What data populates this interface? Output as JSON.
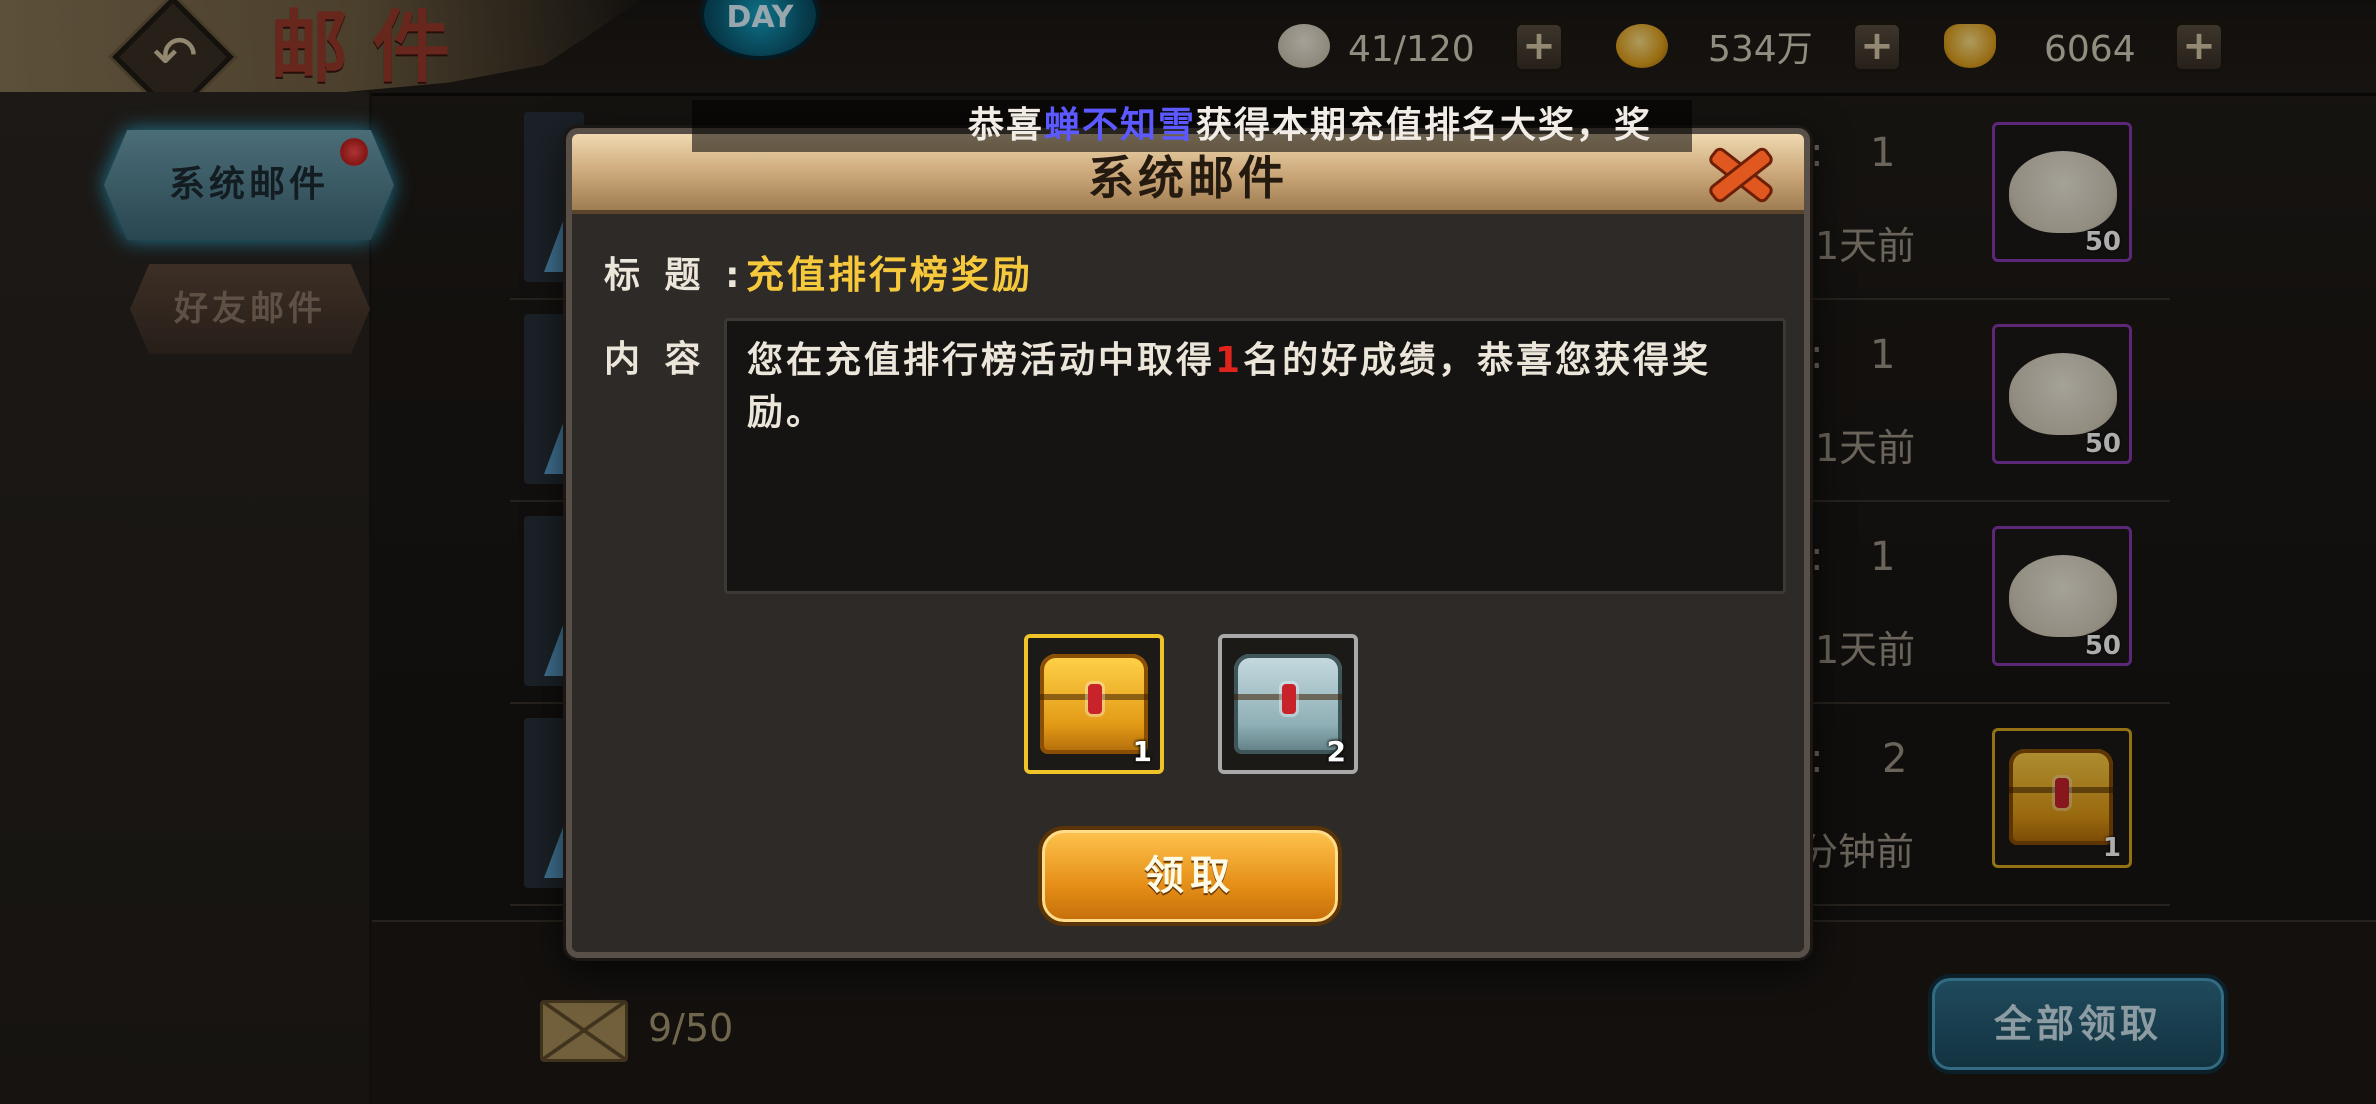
{
  "header": {
    "title": "邮件",
    "logo_text": "DAY"
  },
  "resources": [
    {
      "icon": "bun-icon",
      "value": "41/120"
    },
    {
      "icon": "gold-coin-icon",
      "value": "534万"
    },
    {
      "icon": "gold-ingot-icon",
      "value": "6064"
    }
  ],
  "sidebar": {
    "tabs": [
      {
        "label": "系统邮件",
        "active": true,
        "has_notice": true
      },
      {
        "label": "好友邮件",
        "active": false,
        "has_notice": false
      }
    ]
  },
  "mail_list": {
    "rows": [
      {
        "count": "1",
        "time": "1天前",
        "item": "bun-icon",
        "qty": "50"
      },
      {
        "count": "1",
        "time": "1天前",
        "item": "bun-icon",
        "qty": "50"
      },
      {
        "count": "1",
        "time": "1天前",
        "item": "bun-icon",
        "qty": "50"
      },
      {
        "count": "2",
        "time": "分钟前",
        "item": "gold-chest-icon",
        "qty": "1"
      }
    ],
    "mail_count": "9/50",
    "claim_all_label": "全部领取"
  },
  "marquee": {
    "prefix": "恭喜",
    "name": "蝉不知雪",
    "suffix": "获得本期充值排名大奖，奖"
  },
  "modal": {
    "title": "系统邮件",
    "subject_label": "标 题 :",
    "subject_value": "充值排行榜奖励",
    "content_label": "内 容 :",
    "content_before": "您在充值排行榜活动中取得",
    "content_rank": "1",
    "content_after": "名的好成绩，恭喜您获得奖励。",
    "rewards": [
      {
        "icon": "gold-chest-icon",
        "qty": "1"
      },
      {
        "icon": "silver-chest-icon",
        "qty": "2"
      }
    ],
    "claim_label": "领取"
  },
  "colors": {
    "accent_gold": "#f6c93c",
    "player_name": "#5b59ff",
    "rank_red": "#e1241b",
    "active_tab": "#3fb6d8"
  }
}
